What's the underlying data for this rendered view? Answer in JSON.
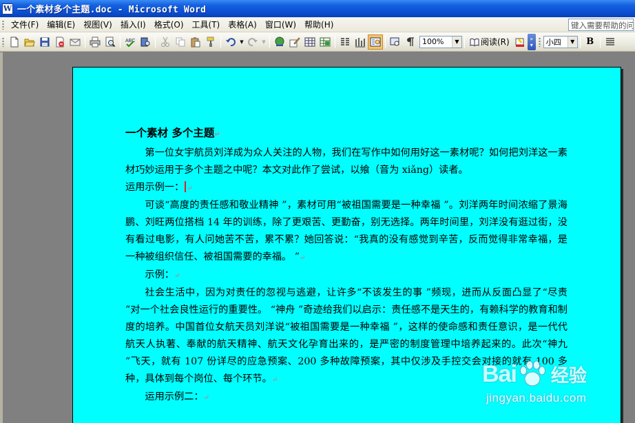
{
  "window": {
    "title": "一个素材多个主题.doc - Microsoft Word",
    "app_icon_letter": "W"
  },
  "menu": {
    "items": [
      "文件(F)",
      "编辑(E)",
      "视图(V)",
      "插入(I)",
      "格式(O)",
      "工具(T)",
      "表格(A)",
      "窗口(W)",
      "帮助(H)"
    ],
    "help_placeholder": "键入需要帮助的问题"
  },
  "toolbar": {
    "zoom": "100%",
    "read_label": "阅读(R)",
    "font_size": "小四",
    "bold_label": "B"
  },
  "document": {
    "title": "一个素材 多个主题",
    "paragraphs": [
      "第一位女宇航员刘洋成为众人关注的人物，我们在写作中如何用好这一素材呢？如何把刘洋这一素材巧妙运用于多个主题之中呢？本文对此作了尝试，以飨（音为 xiǎng）读者。",
      "运用示例一：",
      "可谈“高度的责任感和敬业精神 ”，素材可用“被祖国需要是一种幸福 ”。刘洋两年时间浓缩了景海鹏、刘旺两位搭档 14 年的训练，除了更艰苦、更勤奋，别无选择。两年时间里，刘洋没有逛过街，没有看过电影，有人问她苦不苦，累不累？她回答说：“我真的没有感觉到辛苦，反而觉得非常幸福，是一种被组织信任、被祖国需要的幸福。 ”",
      "示例：",
      "社会生活中，因为对责任的忽视与逃避，让许多“不该发生的事 ”频现，进而从反面凸显了“尽责 ”对一个社会良性运行的重要性。 “神舟 ”奇迹给我们以启示：责任感不是天生的，有赖科学的教育和制度的培养。中国首位女航天员刘洋说“被祖国需要是一种幸福 ”，这样的使命感和责任意识，是一代代航天人执著、奉献的航天精神、航天文化孕育出来的，是严密的制度管理中培养起来的。此次“神九 ”飞天，就有 107 份详尽的应急预案、200 多种故障预案，其中仅涉及手控交会对接的就有 100 多种，具体到每个岗位、每个环节。",
      "运用示例二："
    ]
  },
  "watermark": {
    "brand": "Bai",
    "brand_cn": "经验",
    "url": "jingyan.baidu.com"
  }
}
